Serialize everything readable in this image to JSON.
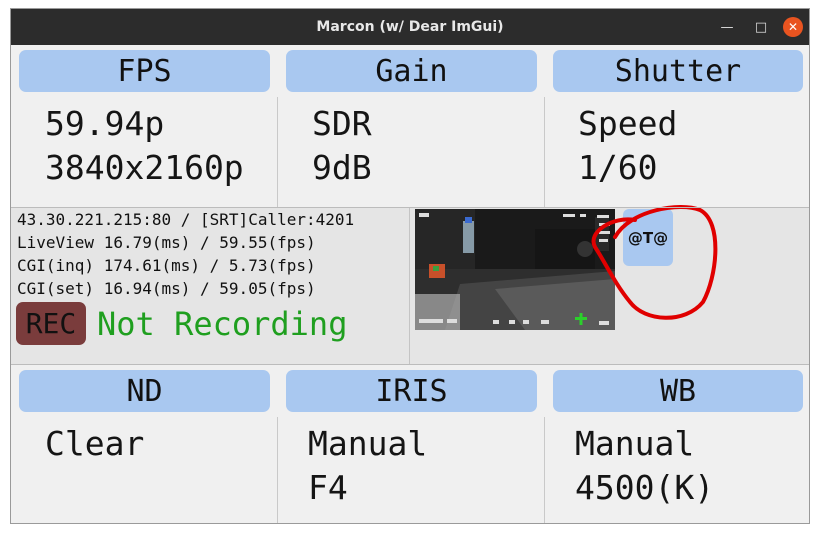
{
  "window": {
    "title": "Marcon (w/ Dear ImGui)"
  },
  "top_panels": [
    {
      "header": "FPS",
      "line1": "59.94p",
      "line2": "3840x2160p"
    },
    {
      "header": "Gain",
      "line1": "SDR",
      "line2": "9dB"
    },
    {
      "header": "Shutter",
      "line1": "Speed",
      "line2": "1/60"
    }
  ],
  "info": {
    "address": "43.30.221.215:80 / [SRT]Caller:4201",
    "liveview": "LiveView 16.79(ms) / 59.55(fps)",
    "cgi_inq": "CGI(inq) 174.61(ms) / 5.73(fps)",
    "cgi_set": "CGI(set) 16.94(ms) / 59.05(fps)",
    "rec_label": "REC",
    "rec_status": "Not Recording"
  },
  "at_button": "@T@",
  "colors": {
    "header_bg": "#a9c8f0",
    "rec_bg": "#7a3c3c",
    "not_recording": "#1f9f1f",
    "annotation": "#e00000"
  },
  "bottom_panels": [
    {
      "header": "ND",
      "line1": "Clear",
      "line2": ""
    },
    {
      "header": "IRIS",
      "line1": "Manual",
      "line2": "F4"
    },
    {
      "header": "WB",
      "line1": "Manual",
      "line2": "4500(K)"
    }
  ]
}
